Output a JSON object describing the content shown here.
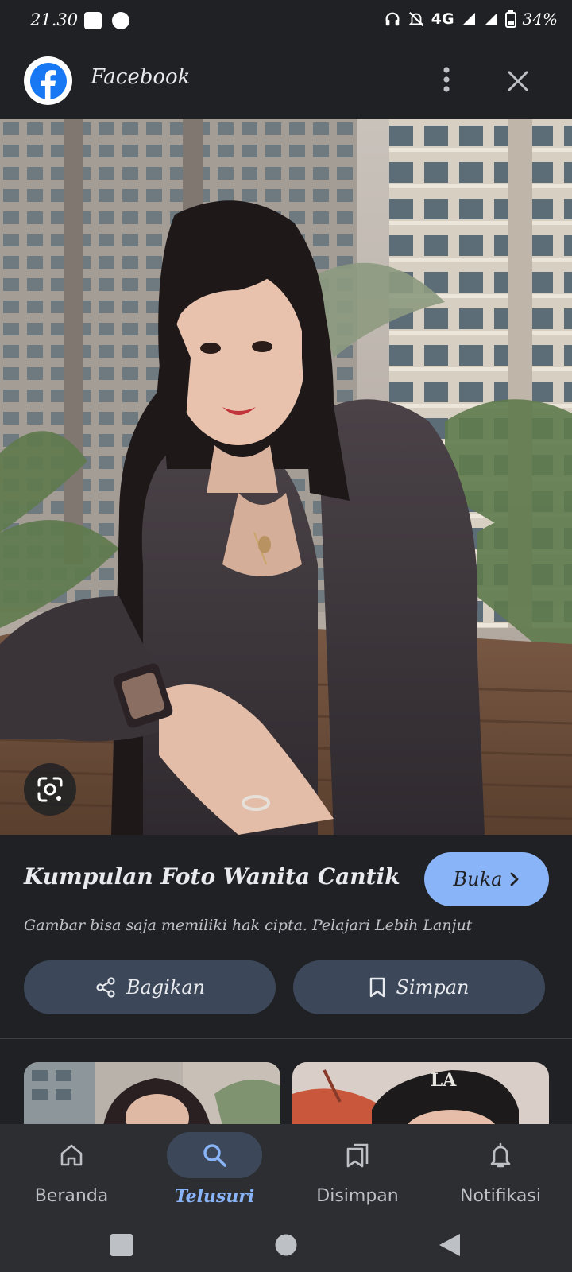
{
  "status_bar": {
    "time": "21.30",
    "network": "4G",
    "battery": "34%"
  },
  "header": {
    "app_name": "Facebook",
    "brand_color": "#1877f2"
  },
  "result": {
    "title": "Kumpulan Foto Wanita Cantik",
    "open_label": "Buka",
    "copyright_notice": "Gambar bisa saja memiliki hak cipta. Pelajari Lebih Lanjut",
    "share_label": "Bagikan",
    "save_label": "Simpan"
  },
  "bottom_nav": {
    "items": [
      {
        "label": "Beranda",
        "icon": "home-icon",
        "active": false
      },
      {
        "label": "Telusuri",
        "icon": "search-icon",
        "active": true
      },
      {
        "label": "Disimpan",
        "icon": "collections-icon",
        "active": false
      },
      {
        "label": "Notifikasi",
        "icon": "bell-icon",
        "active": false
      }
    ]
  },
  "colors": {
    "accent": "#8ab4f8",
    "background": "#202124",
    "button_bg": "#3c4859"
  }
}
